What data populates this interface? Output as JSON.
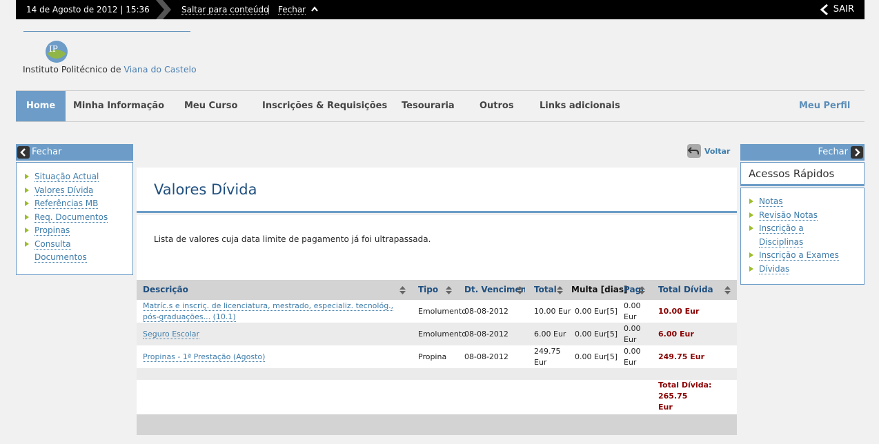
{
  "topbar": {
    "date": "14 de Agosto de 2012 | 15:36",
    "skip_link": "Saltar para conteúdo",
    "separator": "|",
    "close_label": "Fechar",
    "logout_label": "SAIR"
  },
  "logo": {
    "text_main": "Instituto Politécnico de",
    "text_accent": "Viana do Castelo"
  },
  "nav": {
    "items": [
      {
        "label": "Home"
      },
      {
        "label": "Minha Informação"
      },
      {
        "label": "Meu Curso"
      },
      {
        "label": "Inscrições & Requisições"
      },
      {
        "label": "Tesouraria"
      },
      {
        "label": "Outros"
      },
      {
        "label": "Links adicionais"
      }
    ],
    "profile": "Meu Perfil"
  },
  "left_panel": {
    "header": "Fechar",
    "items": [
      {
        "label": "Situação Actual"
      },
      {
        "label": "Valores Dívida"
      },
      {
        "label": "Referências MB"
      },
      {
        "label": "Req. Documentos"
      },
      {
        "label": "Propinas"
      },
      {
        "label": "Consulta"
      },
      {
        "label": "Documentos"
      }
    ]
  },
  "right_panel": {
    "header": "Fechar",
    "title": "Acessos Rápidos",
    "items": [
      {
        "label": "Notas"
      },
      {
        "label": "Revisão Notas"
      },
      {
        "label": "Inscrição a"
      },
      {
        "label": "Disciplinas"
      },
      {
        "label": "Inscrição a Exames"
      },
      {
        "label": "Dívidas"
      }
    ]
  },
  "back_label": "Voltar",
  "main": {
    "title": "Valores Dívida",
    "description": "Lista de valores cuja data limite de pagamento já foi ultrapassada."
  },
  "table": {
    "columns": [
      "Descrição",
      "Tipo",
      "Dt. Vencimento",
      "Total",
      "Multa [dias]",
      "Pago",
      "Total Dívida"
    ],
    "rows": [
      {
        "desc_line1": "Matríc.s e inscriç. de licenciatura, mestrado, especializ. tecnológ.,",
        "desc_line2": "pós-graduações... (10.1)",
        "tipo": "Emolumento",
        "vencimento": "08-08-2012",
        "total_line1": "10.00 Eur",
        "total_line2": "",
        "multa": "0.00 Eur[5]",
        "pago_line1": "0.00",
        "pago_line2": "Eur",
        "divida": "10.00 Eur"
      },
      {
        "desc_line1": "Seguro Escolar",
        "desc_line2": "",
        "tipo": "Emolumento",
        "vencimento": "08-08-2012",
        "total_line1": "6.00 Eur",
        "total_line2": "",
        "multa": "0.00 Eur[5]",
        "pago_line1": "0.00",
        "pago_line2": "Eur",
        "divida": "6.00 Eur"
      },
      {
        "desc_line1": "Propinas - 1ª Prestação (Agosto)",
        "desc_line2": "",
        "tipo": "Propina",
        "vencimento": "08-08-2012",
        "total_line1": "249.75",
        "total_line2": "Eur",
        "multa": "0.00 Eur[5]",
        "pago_line1": "0.00",
        "pago_line2": "Eur",
        "divida": "249.75 Eur"
      }
    ],
    "total_line1": "Total Dívida: 265.75",
    "total_line2": "Eur"
  },
  "colors": {
    "accent": "#6c9cc7",
    "link": "#3f7dab",
    "debt": "#8b0000",
    "bullet": "#9bbd28"
  }
}
